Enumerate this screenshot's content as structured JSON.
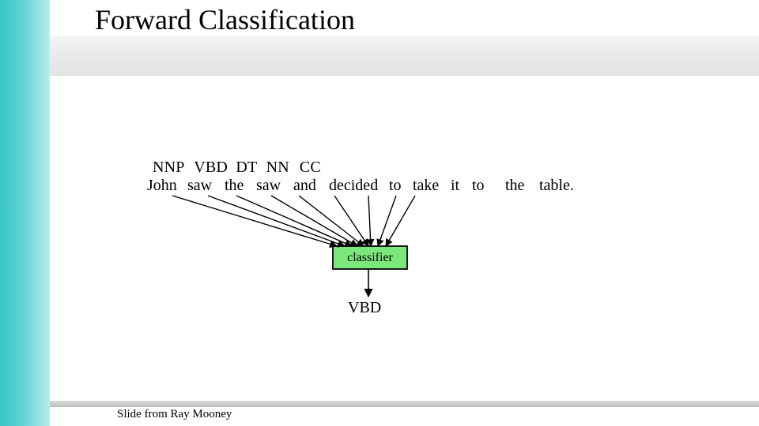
{
  "title": "Forward Classification",
  "tags": {
    "t0": "NNP",
    "t1": "VBD",
    "t2": "DT",
    "t3": "NN",
    "t4": "CC"
  },
  "words": {
    "w0": "John",
    "w1": "saw",
    "w2": "the",
    "w3": "saw",
    "w4": "and",
    "w5": "decided",
    "w6": "to",
    "w7": "take",
    "w8": "it",
    "w9": "to",
    "w10": "the",
    "w11": "table."
  },
  "classifier": {
    "label": "classifier"
  },
  "output": {
    "tag": "VBD"
  },
  "footer": {
    "credit": "Slide from Ray Mooney"
  }
}
